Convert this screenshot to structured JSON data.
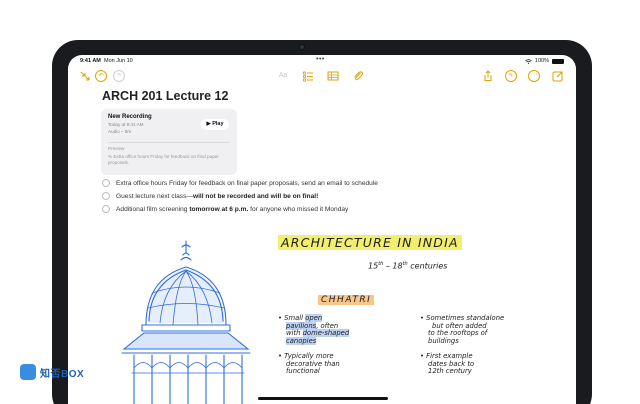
{
  "status_bar": {
    "time": "9:41 AM",
    "date": "Mon Jun 10",
    "battery": "100%",
    "battery_level": 1.0
  },
  "toolbar": {
    "left_icons": [
      "collapse-icon",
      "undo-icon",
      "redo-icon"
    ],
    "center_icons": [
      "text-format-icon",
      "checklist-icon",
      "table-icon",
      "attachment-icon"
    ],
    "text_format_label": "Aa",
    "right_icons": [
      "share-icon",
      "markup-icon",
      "more-icon",
      "compose-icon"
    ],
    "accent_color": "#e0a300"
  },
  "note": {
    "title": "ARCH 201 Lecture 12",
    "recording": {
      "title": "New Recording",
      "timestamp": "Today at 9:41 AM",
      "duration": "Audio – 5m",
      "play_label": "Play",
      "preview_label": "Preview",
      "preview_text": "% Extra office hours Friday for feedback on final paper proposals."
    },
    "checklist": [
      {
        "text": "Extra office hours Friday for feedback on final paper proposals, send an email to schedule"
      },
      {
        "pre": "Guest lecture next class—",
        "bold": "will not be recorded and will be on final!"
      },
      {
        "pre": "Additional film screening ",
        "bold": "tomorrow at 6 p.m.",
        "post": " for anyone who missed it Monday"
      }
    ],
    "handwriting": {
      "heading": "ARCHITECTURE IN INDIA",
      "subheading_century_a": "15",
      "subheading_sup_a": "th",
      "subheading_dash": " – 18",
      "subheading_sup_b": "th",
      "subheading_centuries": " centuries",
      "section": "CHHATRI",
      "left_bullets": {
        "b1_l1": "• Small ",
        "b1_l1_hl": "open",
        "b1_l2_hl": "pavilions",
        "b1_l2": ", often",
        "b1_l3": "with ",
        "b1_l3_hl": "dome-shaped",
        "b1_l4_hl": "canopies",
        "b2_l1": "• Typically more",
        "b2_l2": "decorative than",
        "b2_l3": "functional"
      },
      "right_bullets": {
        "b1_l1": "• Sometimes standalone",
        "b1_l2": "but often added",
        "b1_l3": "to the rooftops of",
        "b1_l4": "buildings",
        "b2_l1": "• First example",
        "b2_l2": "dates back to",
        "b2_l3": "12th century"
      }
    },
    "sketch_color": "#2f6fe0"
  },
  "watermark": {
    "text": "知否BOX"
  }
}
